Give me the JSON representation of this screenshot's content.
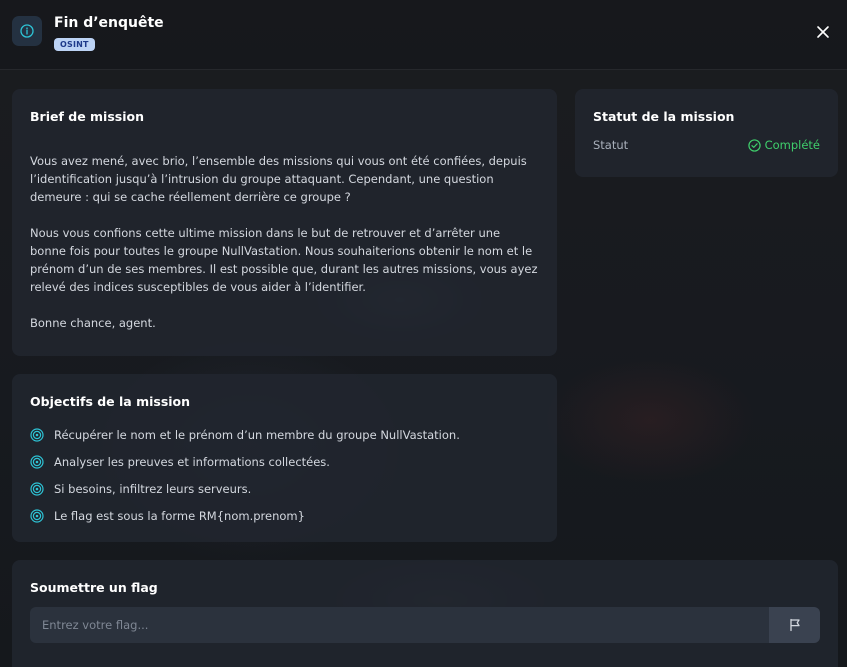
{
  "header": {
    "title": "Fin d’enquête",
    "badge": "OSINT",
    "icon": "info-icon"
  },
  "brief": {
    "title": "Brief de mission",
    "paragraphs": [
      "Vous avez mené, avec brio, l’ensemble des missions qui vous ont été confiées, depuis l’identification jusqu’à l’intrusion du groupe attaquant. Cependant, une question demeure : qui se cache réellement derrière ce groupe ?",
      "Nous vous confions cette ultime mission dans le but de retrouver et d’arrêter une bonne fois pour toutes le groupe NullVastation. Nous souhaiterions obtenir le nom et le prénom d’un de ses membres. Il est possible que, durant les autres missions, vous ayez relevé des indices susceptibles de vous aider à l’identifier.",
      "Bonne chance, agent."
    ]
  },
  "status": {
    "title": "Statut de la mission",
    "label": "Statut",
    "value": "Complété",
    "color": "#3fcf6c"
  },
  "objectives": {
    "title": "Objectifs de la mission",
    "items": [
      "Récupérer le nom et le prénom d’un membre du groupe NullVastation.",
      "Analyser les preuves et informations collectées.",
      "Si besoins, infiltrez leurs serveurs.",
      "Le flag est sous la forme RM{nom.prenom}"
    ]
  },
  "flag": {
    "title": "Soumettre un flag",
    "placeholder": "Entrez votre flag...",
    "value": ""
  },
  "colors": {
    "accent": "#2ec4d6",
    "success": "#3fcf6c",
    "badge_bg": "#bcd3f5"
  }
}
